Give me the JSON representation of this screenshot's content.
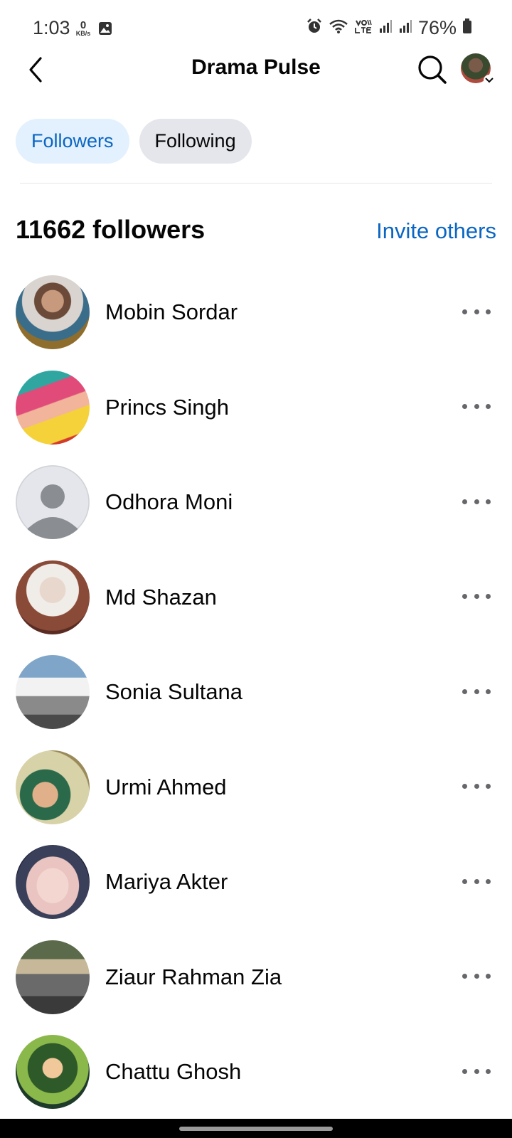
{
  "status_bar": {
    "time": "1:03",
    "net_speed_value": "0",
    "net_speed_unit": "KB/s",
    "battery": "76%",
    "icons": [
      "gallery-icon",
      "alarm-icon",
      "wifi-icon",
      "volte-icon",
      "signal-icon",
      "battery-icon"
    ]
  },
  "header": {
    "title": "Drama Pulse",
    "back_icon": "back-chevron-icon",
    "search_icon": "search-icon",
    "profile_icon": "profile-avatar"
  },
  "tabs": [
    {
      "label": "Followers",
      "active": true
    },
    {
      "label": "Following",
      "active": false
    }
  ],
  "summary": {
    "count_text": "11662 followers",
    "invite_label": "Invite others"
  },
  "followers": [
    {
      "name": "Mobin Sordar"
    },
    {
      "name": "Princs Singh"
    },
    {
      "name": "Odhora Moni"
    },
    {
      "name": "Md Shazan"
    },
    {
      "name": "Sonia Sultana"
    },
    {
      "name": "Urmi Ahmed"
    },
    {
      "name": "Mariya Akter"
    },
    {
      "name": "Ziaur Rahman Zia"
    },
    {
      "name": "Chattu Ghosh"
    }
  ],
  "colors": {
    "accent": "#0a66c2",
    "active_chip_bg": "#e3f0fd",
    "inactive_chip_bg": "#e4e6eb",
    "text": "#050505",
    "secondary": "#65676b"
  }
}
